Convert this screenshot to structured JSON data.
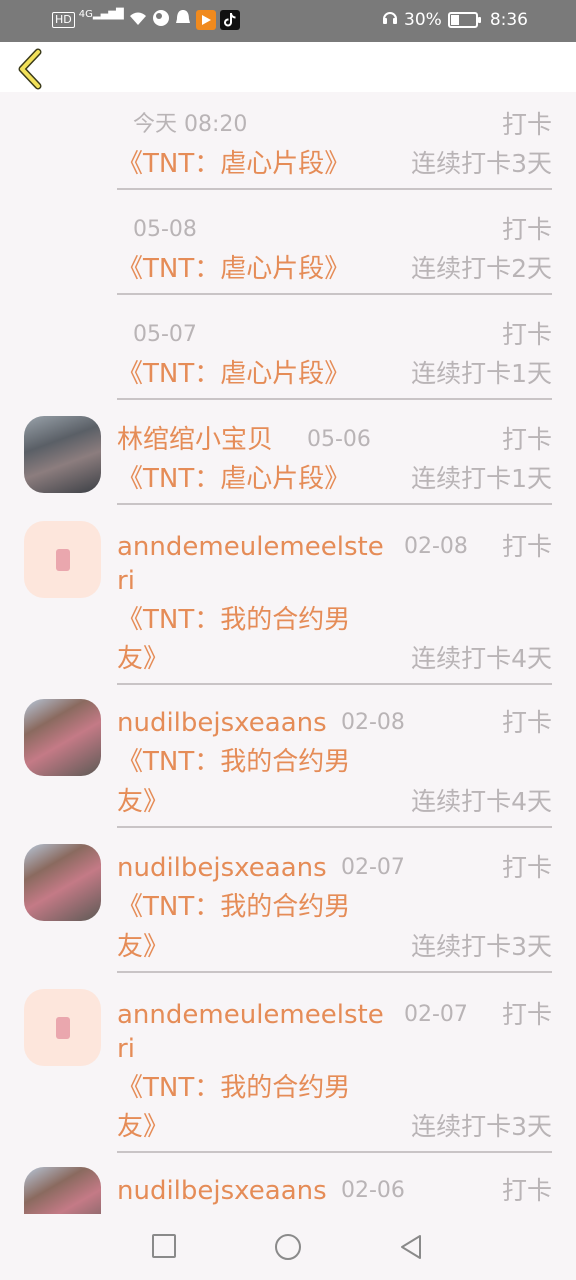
{
  "status_bar": {
    "left_icons": [
      "hd-icon",
      "signal-4g-icon",
      "wifi-icon",
      "globe-icon",
      "notification-icon",
      "app-icon",
      "tiktok-icon"
    ],
    "hd_label": "HD",
    "net_label": "4G",
    "battery_percent": "30%",
    "time": "8:36"
  },
  "header": {
    "back_icon": "chevron-left-icon"
  },
  "items": [
    {
      "avatar": "",
      "name": "",
      "time": "今天 08:20",
      "action": "打卡",
      "book": "《TNT：虐心片段》",
      "streak": "连续打卡3天"
    },
    {
      "avatar": "",
      "name": "",
      "time": "05-08",
      "action": "打卡",
      "book": "《TNT：虐心片段》",
      "streak": "连续打卡2天"
    },
    {
      "avatar": "",
      "name": "",
      "time": "05-07",
      "action": "打卡",
      "book": "《TNT：虐心片段》",
      "streak": "连续打卡1天"
    },
    {
      "avatar": "photo",
      "name": "林绾绾小宝贝",
      "time": "05-06",
      "action": "打卡",
      "book": "《TNT：虐心片段》",
      "streak": "连续打卡1天"
    },
    {
      "avatar": "pink",
      "name_line1": "anndemeulemeelste",
      "name_line2": "ri",
      "time": "02-08",
      "action": "打卡",
      "book_line1": "《TNT：我的合约男",
      "book_line2": "友》",
      "streak": "连续打卡4天"
    },
    {
      "avatar": "photo2",
      "name": "nudilbejsxeaans",
      "time": "02-08",
      "action": "打卡",
      "book_line1": "《TNT：我的合约男",
      "book_line2": "友》",
      "streak": "连续打卡4天"
    },
    {
      "avatar": "photo2",
      "name": "nudilbejsxeaans",
      "time": "02-07",
      "action": "打卡",
      "book_line1": "《TNT：我的合约男",
      "book_line2": "友》",
      "streak": "连续打卡3天"
    },
    {
      "avatar": "pink",
      "name_line1": "anndemeulemeelste",
      "name_line2": "ri",
      "time": "02-07",
      "action": "打卡",
      "book_line1": "《TNT：我的合约男",
      "book_line2": "友》",
      "streak": "连续打卡3天"
    },
    {
      "avatar": "photo2",
      "name": "nudilbejsxeaans",
      "time": "02-06",
      "action": "打卡"
    }
  ],
  "nav_bar": {
    "recents_icon": "square-icon",
    "home_icon": "circle-icon",
    "back_icon": "triangle-back-icon"
  }
}
